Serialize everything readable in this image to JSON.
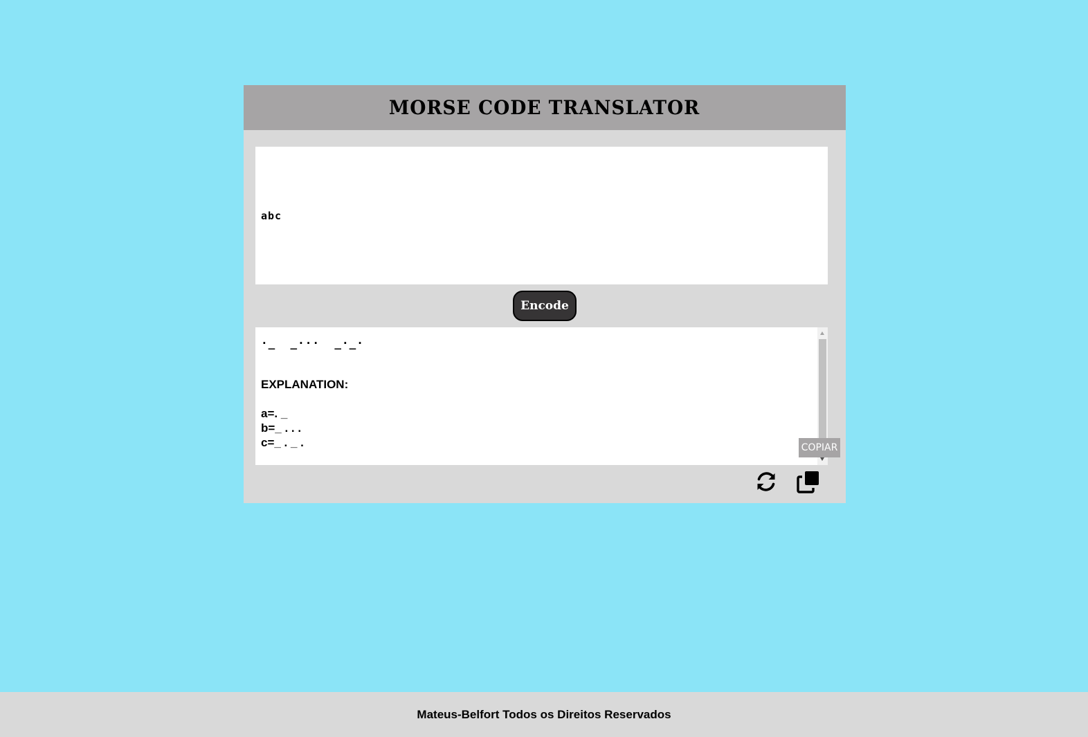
{
  "header": {
    "title": "MORSE CODE TRANSLATOR"
  },
  "input": {
    "value": "abc"
  },
  "encode_button": {
    "label": "Encode"
  },
  "output": {
    "morse": "·_  _···  _·_·",
    "explanation_title": "EXPLANATION:",
    "explanation_items": [
      "a=. _",
      "b=_ . . .",
      "c=_ . _ ."
    ]
  },
  "tooltip": {
    "label": "COPIAR"
  },
  "icons": {
    "refresh": "refresh-icon",
    "copy": "copy-icon"
  },
  "footer": {
    "text": "Mateus-Belfort Todos os Direitos Reservados"
  },
  "colors": {
    "background": "#8be4f7",
    "card": "#d9d9d9",
    "header": "#a6a4a5",
    "button": "#363435"
  }
}
